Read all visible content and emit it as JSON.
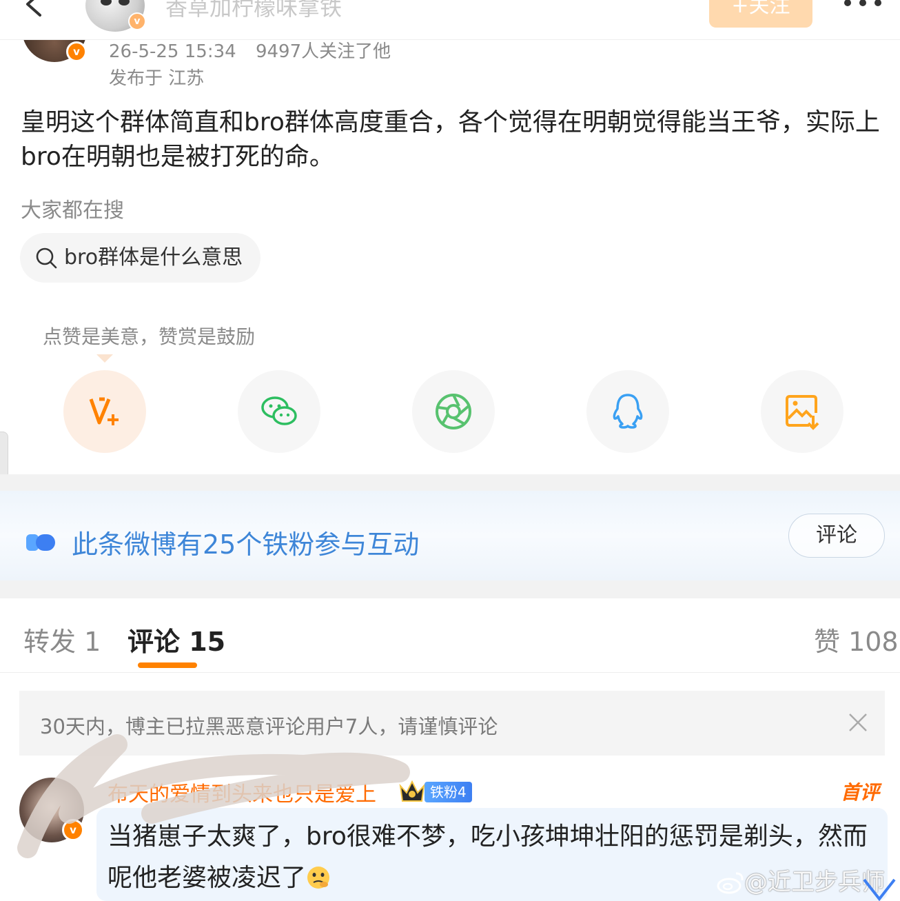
{
  "nav": {
    "title": "香草加柠檬味拿铁",
    "follow_label": "+关注"
  },
  "post": {
    "date": "26-5-25 15:34",
    "followers": "9497人关注了他",
    "location": "发布于 江苏",
    "text": "皇明这个群体简直和bro群体高度重合，各个觉得在明朝觉得能当王爷，实际上bro在明朝也是被打死的命。"
  },
  "search": {
    "hint": "大家都在搜",
    "chip": "bro群体是什么意思"
  },
  "reward": {
    "hint": "点赞是美意，赞赏是鼓励"
  },
  "share": {
    "icons": [
      "reward-v-icon",
      "wechat-icon",
      "moments-icon",
      "qq-icon",
      "save-image-icon"
    ]
  },
  "banner": {
    "text": "此条微博有25个铁粉参与互动",
    "comment_label": "评论"
  },
  "tabs": {
    "repost": "转发 1",
    "comment": "评论 15",
    "like": "赞 108"
  },
  "notice": {
    "text": "30天内，博主已拉黑恶意评论用户7人，请谨慎评论"
  },
  "comment": {
    "username": "布天的爱情到头来也只是爱上",
    "fan_badge": "铁粉4",
    "first_label": "首评",
    "text": "当猪崽子太爽了，bro很难不梦，吃小孩坤坤壮阳的惩罚是剃头，然而呢他老婆被凌迟了"
  },
  "watermark": "@近卫步兵师",
  "colors": {
    "accent": "#ff8200",
    "link_blue": "#3e86d8",
    "muted": "#8a8a8a"
  }
}
